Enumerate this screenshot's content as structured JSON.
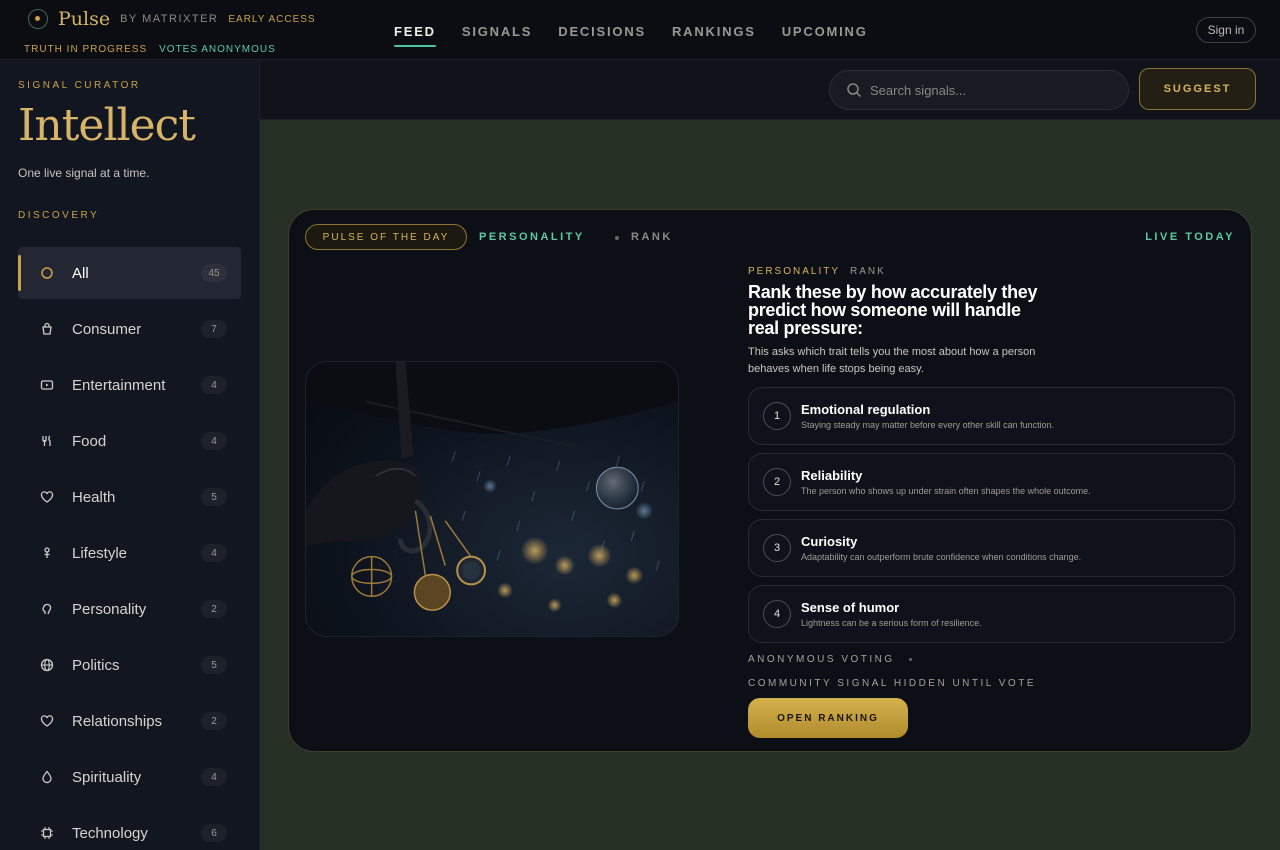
{
  "brand": {
    "name": "Pulse",
    "by": "BY MATRIXTER",
    "badge": "EARLY ACCESS",
    "tag1": "TRUTH IN PROGRESS",
    "tag2": "VOTES ANONYMOUS"
  },
  "nav": {
    "items": [
      "FEED",
      "SIGNALS",
      "DECISIONS",
      "RANKINGS",
      "UPCOMING"
    ],
    "active": "FEED",
    "signin": "Sign in"
  },
  "sidebar": {
    "kicker": "SIGNAL CURATOR",
    "title": "Intellect",
    "tagline": "One live signal at a time.",
    "section": "DISCOVERY",
    "items": [
      {
        "label": "All",
        "count": "45",
        "icon": "circle-icon"
      },
      {
        "label": "Consumer",
        "count": "7",
        "icon": "shopping-bag-icon"
      },
      {
        "label": "Entertainment",
        "count": "4",
        "icon": "play-icon"
      },
      {
        "label": "Food",
        "count": "4",
        "icon": "utensils-icon"
      },
      {
        "label": "Health",
        "count": "5",
        "icon": "heart-icon"
      },
      {
        "label": "Lifestyle",
        "count": "4",
        "icon": "person-icon"
      },
      {
        "label": "Personality",
        "count": "2",
        "icon": "brain-icon"
      },
      {
        "label": "Politics",
        "count": "5",
        "icon": "globe-icon"
      },
      {
        "label": "Relationships",
        "count": "2",
        "icon": "heart-icon"
      },
      {
        "label": "Spirituality",
        "count": "4",
        "icon": "flame-icon"
      },
      {
        "label": "Technology",
        "count": "6",
        "icon": "chip-icon"
      }
    ]
  },
  "toolbar": {
    "search_placeholder": "Search signals...",
    "suggest": "SUGGEST"
  },
  "card": {
    "pulse_chip": "PULSE OF THE DAY",
    "category": "PERSONALITY",
    "mode": "RANK",
    "live": "LIVE TODAY",
    "meta_category": "PERSONALITY",
    "meta_mode": "RANK",
    "title": "Rank these by how accurately they predict how someone will handle real pressure:",
    "description": "This asks which trait tells you the most about how a person behaves when life stops being easy.",
    "options": [
      {
        "num": "1",
        "title": "Emotional regulation",
        "sub": "Staying steady may matter before every other skill can function."
      },
      {
        "num": "2",
        "title": "Reliability",
        "sub": "The person who shows up under strain often shapes the whole outcome."
      },
      {
        "num": "3",
        "title": "Curiosity",
        "sub": "Adaptability can outperform brute confidence when conditions change."
      },
      {
        "num": "4",
        "title": "Sense of humor",
        "sub": "Lightness can be a serious form of resilience."
      }
    ],
    "voting": "ANONYMOUS VOTING",
    "hidden_note": "COMMUNITY SIGNAL HIDDEN UNTIL VOTE",
    "cta": "OPEN RANKING"
  },
  "colors": {
    "accent_gold": "#c9a24a",
    "accent_teal": "#5cc9a7",
    "content_bg": "#263024"
  }
}
